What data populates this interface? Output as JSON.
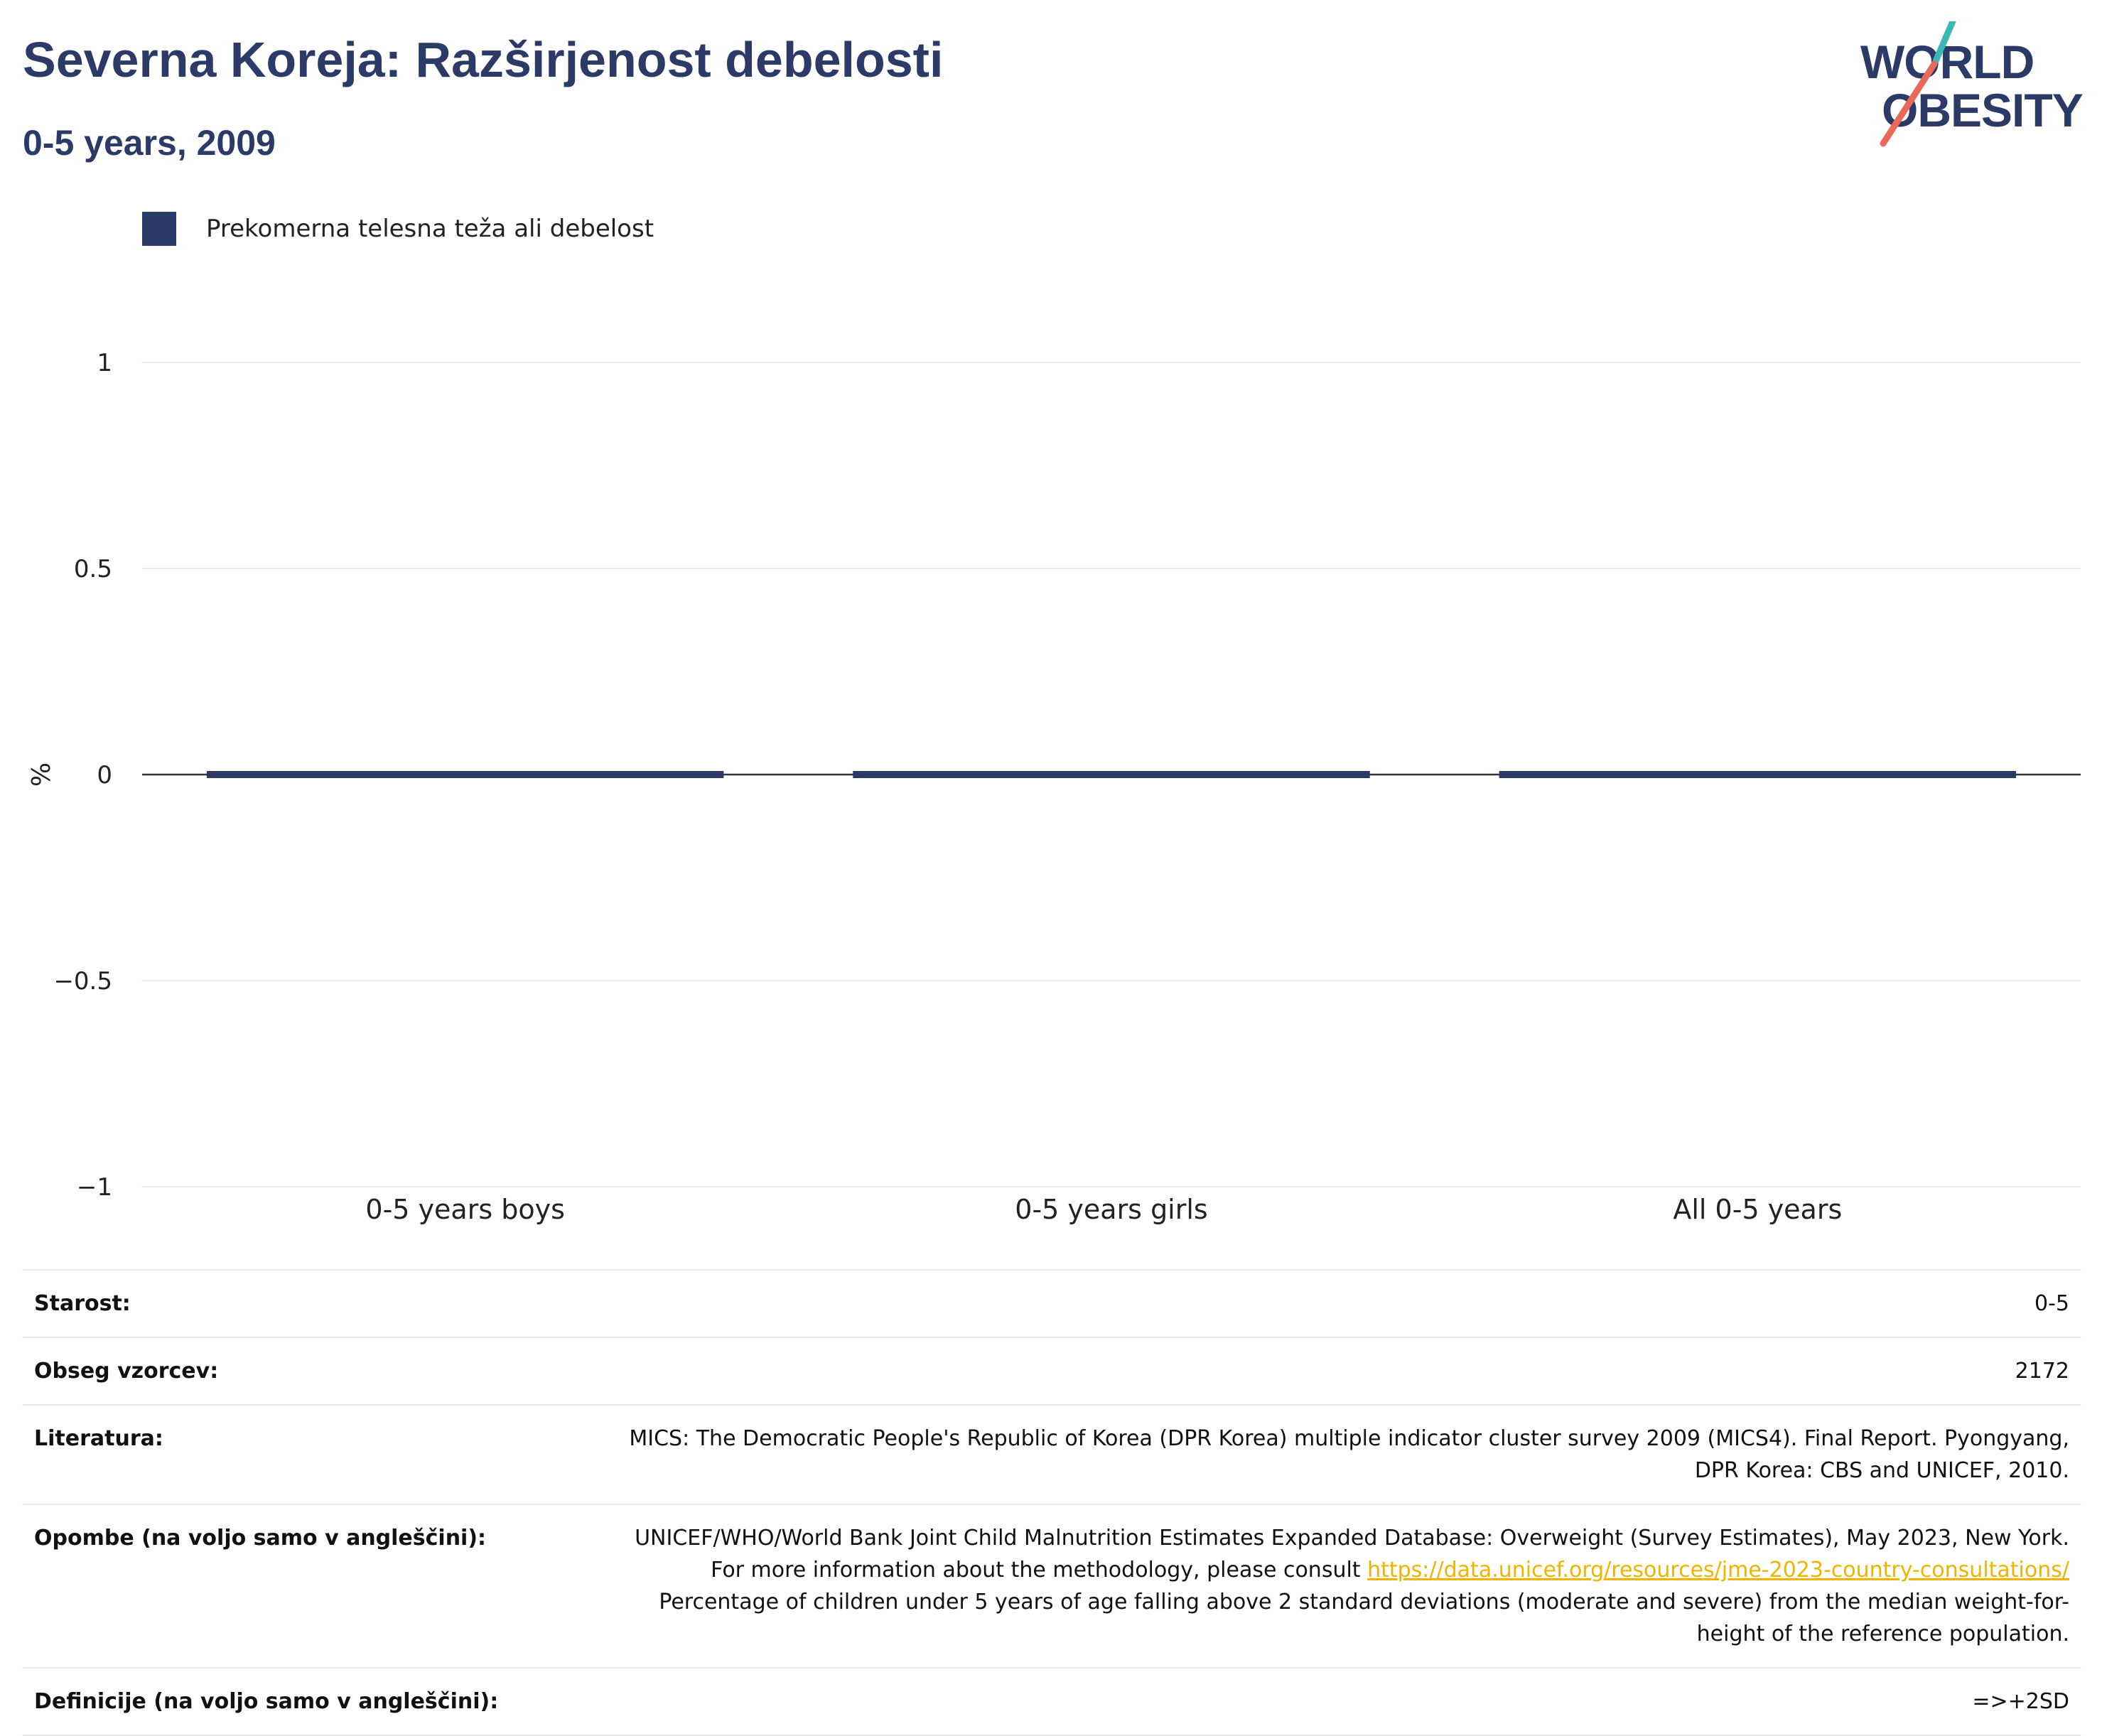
{
  "header": {
    "title": "Severna Koreja: Razširjenost debelosti",
    "subtitle": "0-5 years, 2009"
  },
  "logo": {
    "line1": "WORLD",
    "line2": "OBESITY"
  },
  "colors": {
    "navy": "#2b3a67",
    "teal": "#3bb8b4",
    "coral": "#ea6a5a",
    "link": "#f0b400"
  },
  "legend": {
    "items": [
      {
        "label": "Prekomerna telesna teža ali debelost",
        "color": "#2b3a67"
      }
    ]
  },
  "chart_data": {
    "type": "bar",
    "title": "Severna Koreja: Razširjenost debelosti",
    "subtitle": "0-5 years, 2009",
    "categories": [
      "0-5 years boys",
      "0-5 years girls",
      "All 0-5 years"
    ],
    "series": [
      {
        "name": "Prekomerna telesna teža ali debelost",
        "values": [
          0,
          0,
          0
        ]
      }
    ],
    "ylabel": "%",
    "xlabel": "",
    "ylim": [
      -1,
      1
    ],
    "yticks": [
      1,
      0.5,
      0,
      -0.5,
      -1
    ],
    "ytick_labels": [
      "1",
      "0.5",
      "0",
      "−0.5",
      "−1"
    ],
    "grid": true,
    "legend_position": "top-left"
  },
  "info": {
    "rows": [
      {
        "key": "Starost:",
        "value": "0-5"
      },
      {
        "key": "Obseg vzorcev:",
        "value": "2172"
      },
      {
        "key": "Literatura:",
        "value": "MICS: The Democratic People's Republic of Korea (DPR Korea) multiple indicator cluster survey 2009 (MICS4). Final Report. Pyongyang, DPR Korea: CBS and UNICEF, 2010."
      },
      {
        "key": "Opombe (na voljo samo v angleščini):",
        "value_pre": "UNICEF/WHO/World Bank Joint Child Malnutrition Estimates Expanded Database: Overweight (Survey Estimates), May 2023, New York. For more information about the methodology, please consult ",
        "link": "https://data.unicef.org/resources/jme-2023-country-consultations/",
        "value_post": " Percentage of children under 5 years of age falling above 2 standard deviations (moderate and severe) from the median weight-for-height of the reference population."
      },
      {
        "key": "Definicije (na voljo samo v angleščini):",
        "value": "=>+2SD"
      }
    ]
  }
}
